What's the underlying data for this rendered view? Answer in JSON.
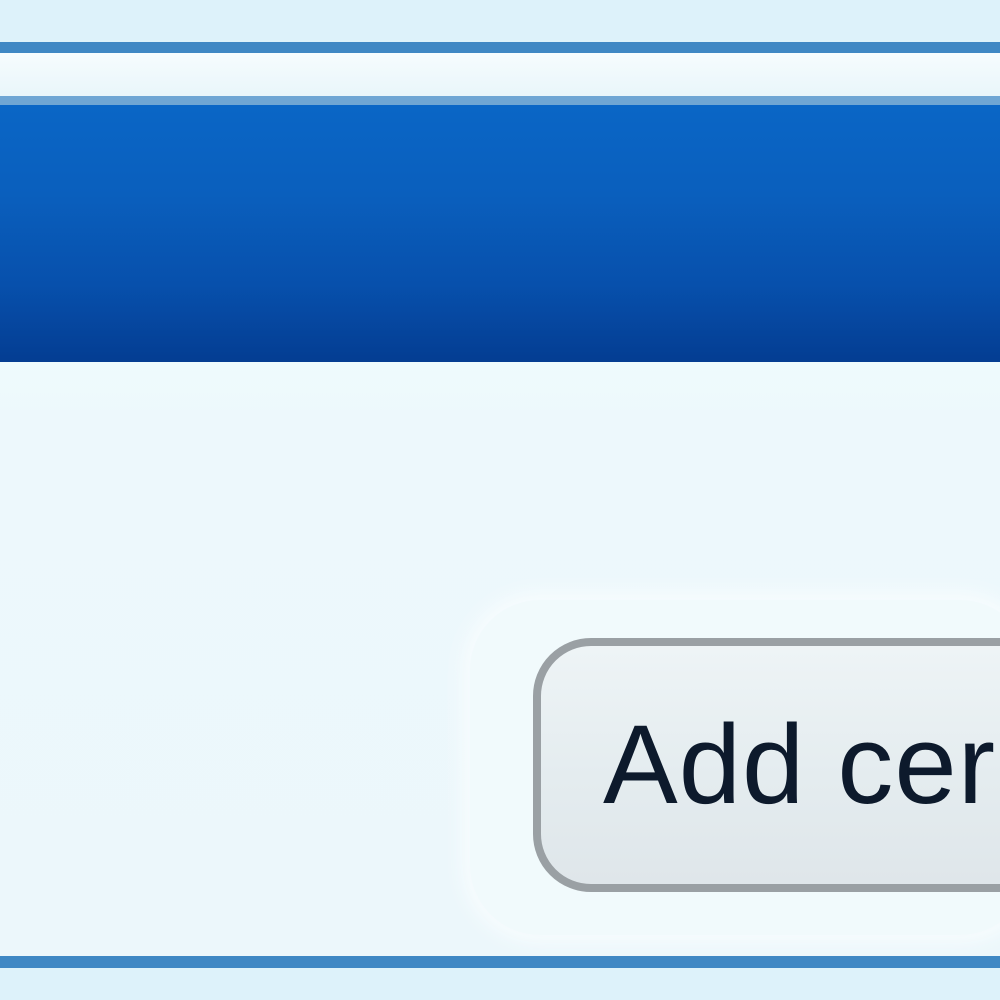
{
  "dialog": {
    "title": "",
    "add_button_label": "Add cer"
  },
  "colors": {
    "title_bar_top": "#0a66c6",
    "title_bar_bottom": "#043d92",
    "rule": "#3f88c4",
    "background": "#ecf7fb",
    "button_border": "#9aa0a4"
  }
}
